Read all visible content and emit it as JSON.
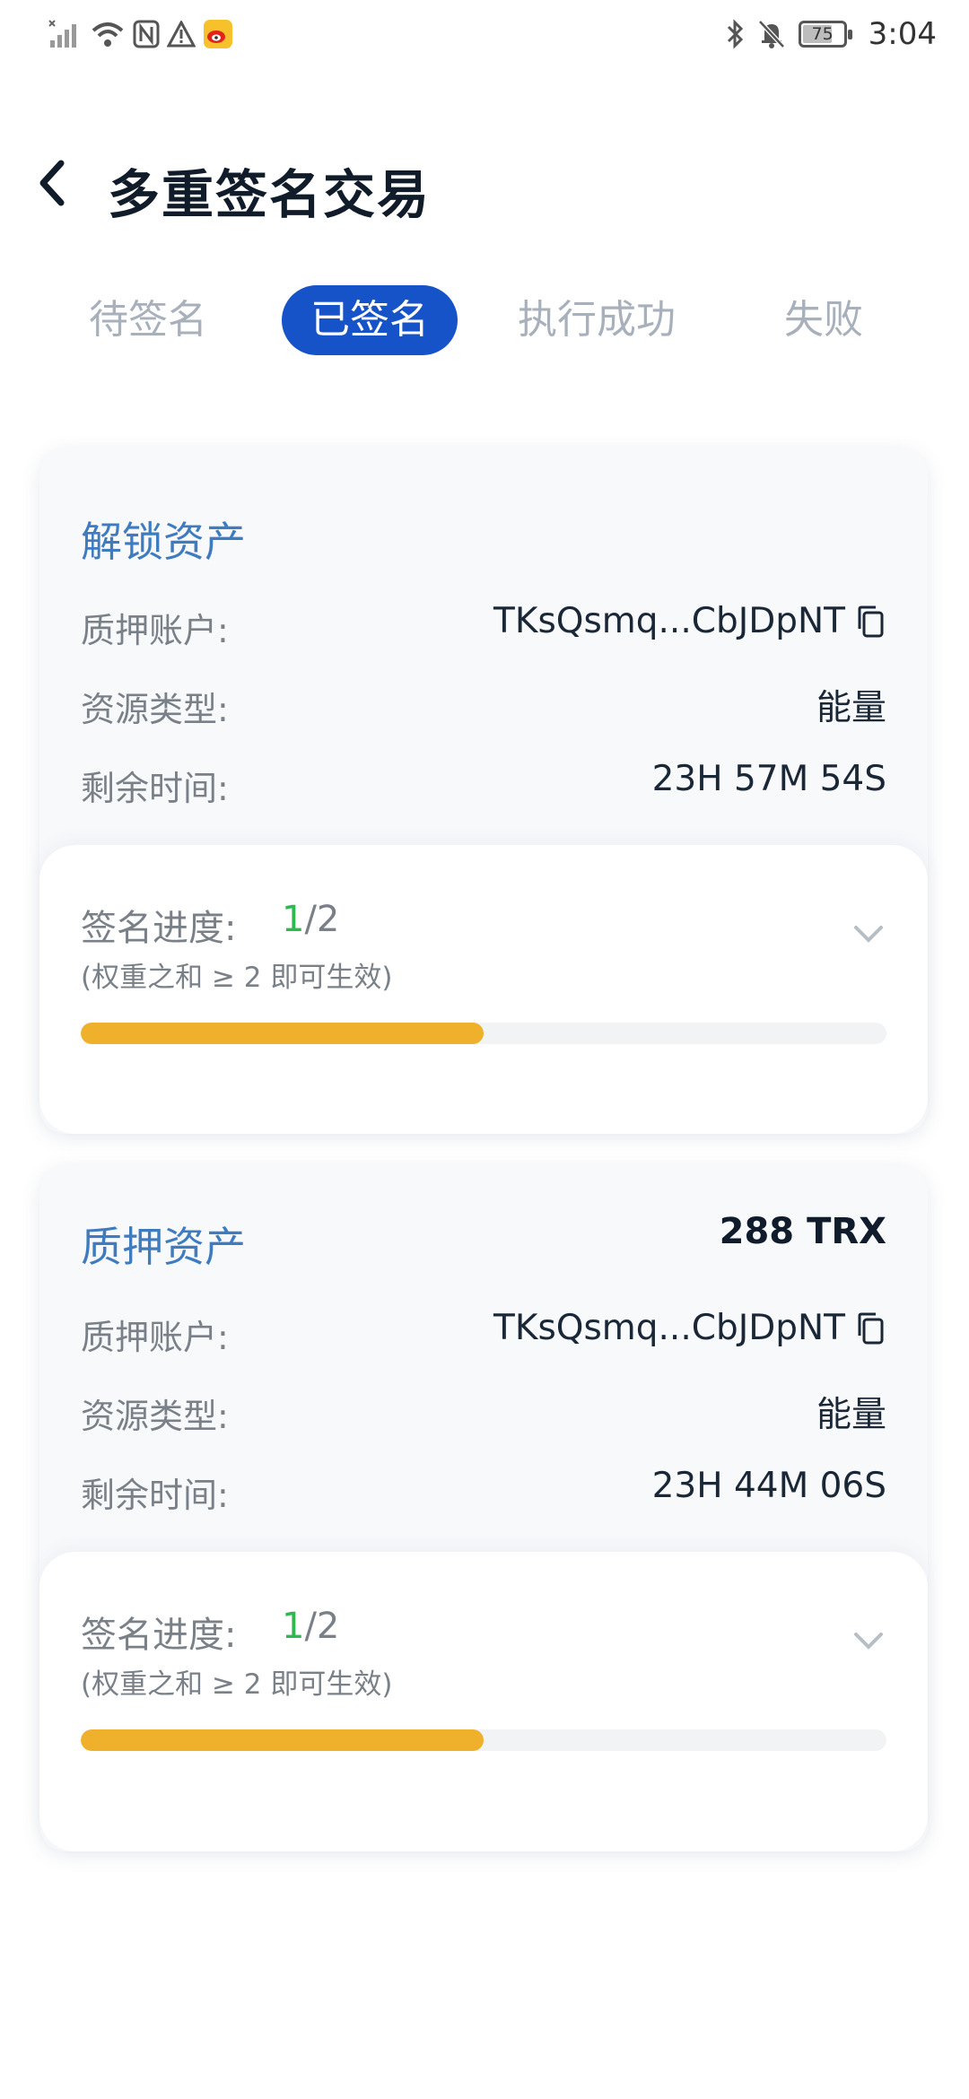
{
  "status_bar": {
    "time": "3:04",
    "battery": {
      "label": "75",
      "level": 0.75
    },
    "icons": [
      "signal-icon",
      "wifi-icon",
      "nfc-icon",
      "warning-icon",
      "weibo-icon",
      "bluetooth-icon",
      "bell-off-icon",
      "battery-icon"
    ]
  },
  "header": {
    "title": "多重签名交易",
    "back_icon": "back-arrow-icon"
  },
  "tabs": [
    {
      "label": "待签名",
      "active": false
    },
    {
      "label": "已签名",
      "active": true
    },
    {
      "label": "执行成功",
      "active": false
    },
    {
      "label": "失败",
      "active": false
    }
  ],
  "cards": [
    {
      "title": "解锁资产",
      "amount": "",
      "rows": [
        {
          "label": "质押账户:",
          "value": "TKsQsmq...CbJDpNT",
          "copyable": true
        },
        {
          "label": "资源类型:",
          "value": "能量"
        },
        {
          "label": "剩余时间:",
          "value": "23H 57M 54S"
        }
      ],
      "progress": {
        "label": "签名进度:",
        "signed": "1",
        "total": "/2",
        "hint": "(权重之和 ≥ 2 即可生效)",
        "fraction": 0.5
      }
    },
    {
      "title": "质押资产",
      "amount": "288 TRX",
      "rows": [
        {
          "label": "质押账户:",
          "value": "TKsQsmq...CbJDpNT",
          "copyable": true
        },
        {
          "label": "资源类型:",
          "value": "能量"
        },
        {
          "label": "剩余时间:",
          "value": "23H 44M 06S"
        }
      ],
      "progress": {
        "label": "签名进度:",
        "signed": "1",
        "total": "/2",
        "hint": "(权重之和 ≥ 2 即可生效)",
        "fraction": 0.5
      }
    }
  ],
  "colors": {
    "accent": "#1653c8",
    "card_title": "#3f7bbf",
    "progress": "#efb12c",
    "signed": "#2fb84f"
  }
}
